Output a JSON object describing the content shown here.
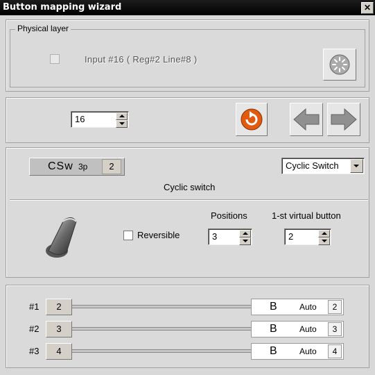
{
  "window": {
    "title": "Button mapping wizard",
    "close": "✕"
  },
  "physical_layer": {
    "label": "Physical layer",
    "input_text": "Input #16  ( Reg#2  Line#8 )",
    "action_icon": "sun-icon"
  },
  "navigation": {
    "input_number": "16",
    "refresh_icon": "refresh-icon",
    "back_icon": "arrow-left-icon",
    "forward_icon": "arrow-right-icon"
  },
  "mode": {
    "csw_label": "CSw",
    "csw_sub": "3p",
    "csw_num": "2",
    "select_value": "Cyclic Switch",
    "description": "Cyclic switch"
  },
  "config": {
    "reversible_label": "Reversible",
    "positions_label": "Positions",
    "positions_value": "3",
    "first_virtual_label": "1-st virtual button",
    "first_virtual_value": "2"
  },
  "mappings": [
    {
      "label": "#1",
      "button": "2",
      "target": "B",
      "auto": "Auto",
      "auto_num": "2"
    },
    {
      "label": "#2",
      "button": "3",
      "target": "B",
      "auto": "Auto",
      "auto_num": "3"
    },
    {
      "label": "#3",
      "button": "4",
      "target": "B",
      "auto": "Auto",
      "auto_num": "4"
    }
  ]
}
